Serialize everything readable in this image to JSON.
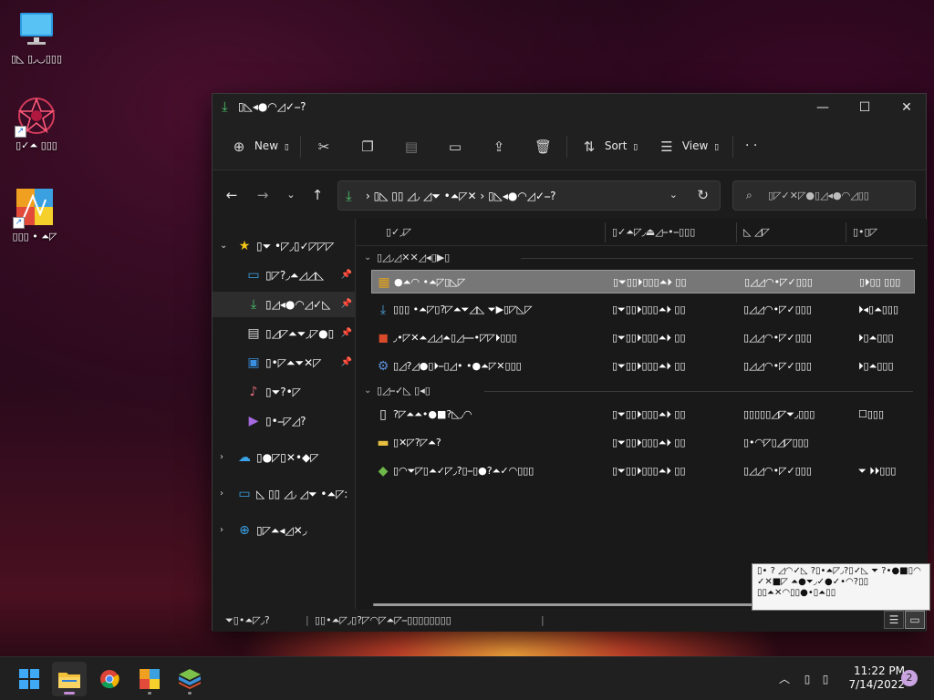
{
  "desktop": {
    "icons": [
      {
        "name": "This PC",
        "label": "▯◺ ▯◞◡▯▯▯"
      },
      {
        "name": "Shortcut app",
        "label": "▯✓⏶ ▯▯▯"
      },
      {
        "name": "Shortcut app 2",
        "label": "▯▯▯ • ⏶◸"
      }
    ]
  },
  "window": {
    "title": "▯◺◂●◠◿✓⎯?",
    "controls": {
      "minimize": "—",
      "maximize": "☐",
      "close": "✕"
    }
  },
  "toolbar": {
    "new_label": "New",
    "new_suffix": "▯",
    "sort_label": "Sort",
    "sort_suffix": "▯",
    "view_label": "View",
    "view_suffix": "▯",
    "more": "· ·"
  },
  "address": {
    "path": "› ▯◺ ▯▯ ◿◞ ◿⏷ •⏶◸✕  › ▯◺◂●◠◿✓⎯?",
    "search_placeholder": "▯◸✓✕◸●▯◿◂●◠◿▯▯"
  },
  "sidebar": {
    "items": [
      {
        "label": "▯⏷ •◸◞▯✓◸◸◸",
        "icon": "★"
      },
      {
        "label": "▯◸?◞⏶◿◿◺",
        "icon": "▭"
      },
      {
        "label": "▯◿◂●◠◿✓◺",
        "icon": "⤓"
      },
      {
        "label": "▯◿◸⏶⏷◞◸●▯",
        "icon": "▤"
      },
      {
        "label": "▯•◸⏶⏷✕◸",
        "icon": "▣"
      },
      {
        "label": "▯⏷?•◸",
        "icon": "♪"
      },
      {
        "label": "▯•⎯◸◿?",
        "icon": "▶"
      },
      {
        "label": "▯●◸▯✕•◆◸",
        "icon": "☁"
      },
      {
        "label": "◺ ▯▯ ◿◞ ◿⏷ •⏶◸:",
        "icon": "▭"
      },
      {
        "label": "▯◸⏶◂◿✕◞",
        "icon": "⊕"
      }
    ]
  },
  "content": {
    "columns": [
      "▯✓◞◸",
      "▯✓⏶◸◞⏏◿⎯•⎯▯▯▯",
      "◺ ◿◸",
      "▯•▯◸"
    ],
    "groups": [
      "▯◿◞◿✕✕◿◂▯▶▯",
      "▯◿⎯✓◺ ▯◂▯"
    ],
    "rows": [
      {
        "name": "●⏶◠ •⏶◸▯◺◸",
        "date": "▯⏷▯▯⏵▯▯▯⏶⏵ ▯▯",
        "type": "▯◿◿◠•◸✓▯▯▯",
        "size": "▯⏵▯▯ ▯▯▯",
        "icon": "▦",
        "icon_color": "#e0a020",
        "selected": true
      },
      {
        "name": "▯▯▯ •⏶◸▯?◸⏶⏷◿◺ ⏷▶▯◸◺◸",
        "date": "▯⏷▯▯⏵▯▯▯⏶⏵ ▯▯",
        "type": "▯◿◿◠•◸✓▯▯▯",
        "size": "⏵◂▯⏶▯▯▯",
        "icon": "⤓",
        "icon_color": "#4fa3e0",
        "selected": false
      },
      {
        "name": "◞•◸✕⏶◿◿⏶▯◿⎯⎯•◸◸⏵▯▯▯",
        "date": "▯⏷▯▯⏵▯▯▯⏶⏵ ▯▯",
        "type": "▯◿◿◠•◸✓▯▯▯",
        "size": "⏵▯⏶▯▯▯",
        "icon": "◼",
        "icon_color": "#d84a2a",
        "selected": false
      },
      {
        "name": "▯◿?◿●▯⏵⎯▯◿• •●⏶◸✕▯▯▯",
        "date": "▯⏷▯▯⏵▯▯▯⏶⏵ ▯▯",
        "type": "▯◿◿◠•◸✓▯▯▯",
        "size": "⏵▯⏶▯▯▯",
        "icon": "⚙",
        "icon_color": "#5a8fd8",
        "selected": false
      },
      {
        "name": "?◸⏶⏶•●■?◺◞◠",
        "date": "▯⏷▯▯⏵▯▯▯⏶⏵ ▯▯",
        "type": "▯▯▯▯▯◿◸⏷◞▯▯▯",
        "size": "☐▯▯▯",
        "icon": "▯",
        "icon_color": "#f0f0f0",
        "selected": false
      },
      {
        "name": "▯✕◸?◸⏶?",
        "date": "▯⏷▯▯⏵▯▯▯⏶⏵ ▯▯",
        "type": "▯•◠◸▯◿◸▯▯▯",
        "size": "",
        "icon": "▬",
        "icon_color": "#e8c040",
        "selected": false
      },
      {
        "name": "▯◠⏷◸▯⏶✓◸◞?▯⎯▯●?⏶✓◠▯▯▯",
        "date": "▯⏷▯▯⏵▯▯▯⏶⏵ ▯▯",
        "type": "▯◿◿◠•◸✓▯▯▯",
        "size": "⏷ ⏵⏵▯▯▯",
        "icon": "◆",
        "icon_color": "#6fb84a",
        "selected": false
      }
    ]
  },
  "statusbar": {
    "items_count": "⏷▯•⏶◸◞?",
    "selected": "▯▯•⏶◸◞▯?◸◠◸⏶◸⎯▯▯▯▯▯▯▯▯"
  },
  "tooltip": {
    "text": "▯• ? ◿◠✓◺ ?▯•⏶◸◞?▯✓◺ ⏷ ?•●■▯◠ ✓✕■◸ ⏶●⏷◞✓●✓•◠?▯▯ ▯▯⏶✕◠▯▯●•▯⏶▯▯"
  },
  "taskbar": {
    "time": "11:22 PM",
    "date": "7/14/2022",
    "notifications": "2"
  }
}
